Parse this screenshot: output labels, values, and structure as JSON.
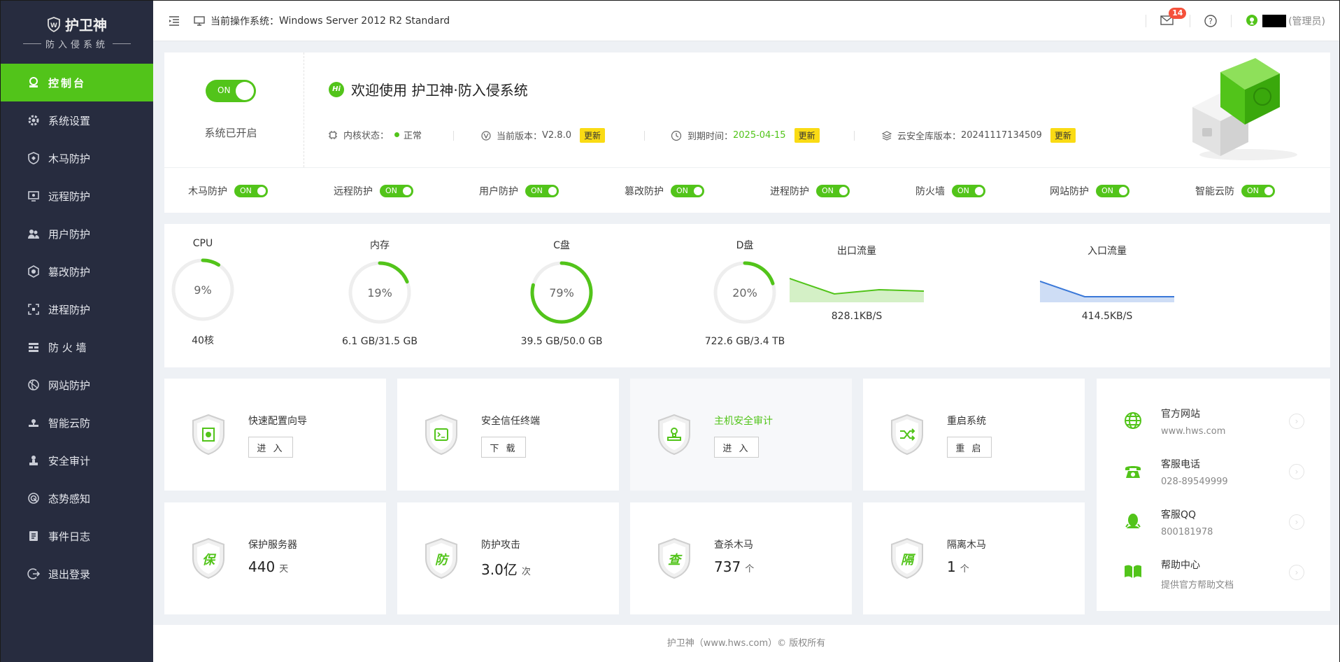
{
  "brand": {
    "name": "护卫神",
    "subtitle": "防入侵系统"
  },
  "sidebar": {
    "items": [
      {
        "label": "控制台",
        "icon": "dashboard-icon",
        "active": true
      },
      {
        "label": "系统设置",
        "icon": "gear-icon"
      },
      {
        "label": "木马防护",
        "icon": "shield-icon"
      },
      {
        "label": "远程防护",
        "icon": "remote-desktop-icon"
      },
      {
        "label": "用户防护",
        "icon": "users-icon"
      },
      {
        "label": "篡改防护",
        "icon": "tamper-icon"
      },
      {
        "label": "进程防护",
        "icon": "process-icon"
      },
      {
        "label": "防 火 墙",
        "icon": "firewall-icon"
      },
      {
        "label": "网站防护",
        "icon": "website-icon"
      },
      {
        "label": "智能云防",
        "icon": "cloud-icon"
      },
      {
        "label": "安全审计",
        "icon": "audit-icon"
      },
      {
        "label": "态势感知",
        "icon": "radar-icon"
      },
      {
        "label": "事件日志",
        "icon": "log-icon"
      },
      {
        "label": "退出登录",
        "icon": "logout-icon"
      }
    ]
  },
  "topbar": {
    "os_label": "当前操作系统：",
    "os_value": "Windows Server 2012 R2 Standard",
    "mail_count": "14",
    "user_role": "(管理员)"
  },
  "status": {
    "switch_label": "ON",
    "system_state": "系统已开启",
    "welcome": "欢迎使用 护卫神·防入侵系统",
    "hi_badge": "Hi",
    "kernel_label": "内核状态：",
    "kernel_value": "正常",
    "version_label": "当前版本：",
    "version_value": "V2.8.0",
    "expire_label": "到期时间：",
    "expire_value": "2025-04-15",
    "cloud_label": "云安全库版本：",
    "cloud_value": "20241117134509",
    "update_label": "更新"
  },
  "protections": [
    {
      "label": "木马防护",
      "state": "ON"
    },
    {
      "label": "远程防护",
      "state": "ON"
    },
    {
      "label": "用户防护",
      "state": "ON"
    },
    {
      "label": "篡改防护",
      "state": "ON"
    },
    {
      "label": "进程防护",
      "state": "ON"
    },
    {
      "label": "防火墙",
      "state": "ON"
    },
    {
      "label": "网站防护",
      "state": "ON"
    },
    {
      "label": "智能云防",
      "state": "ON"
    }
  ],
  "gauges": [
    {
      "label": "CPU",
      "percent": 9,
      "percent_text": "9%",
      "detail": "40核"
    },
    {
      "label": "内存",
      "percent": 19,
      "percent_text": "19%",
      "detail": "6.1 GB/31.5 GB"
    },
    {
      "label": "C盘",
      "percent": 79,
      "percent_text": "79%",
      "detail": "39.5 GB/50.0 GB"
    },
    {
      "label": "D盘",
      "percent": 20,
      "percent_text": "20%",
      "detail": "722.6 GB/3.4 TB"
    }
  ],
  "traffic": [
    {
      "label": "出口流量",
      "value": "828.1KB/S",
      "color": "#52c41a",
      "points": [
        34,
        12,
        18,
        16
      ]
    },
    {
      "label": "入口流量",
      "value": "414.5KB/S",
      "color": "#3a78d8",
      "points": [
        30,
        8,
        8,
        8
      ]
    }
  ],
  "actions": [
    {
      "title": "快速配置向导",
      "button": "进 入",
      "icon": "wizard-icon"
    },
    {
      "title": "安全信任终端",
      "button": "下 载",
      "icon": "terminal-icon"
    },
    {
      "title": "主机安全审计",
      "button": "进 入",
      "icon": "stamp-icon",
      "highlight": true
    },
    {
      "title": "重启系统",
      "button": "重 启",
      "icon": "shuffle-icon"
    }
  ],
  "counters": [
    {
      "title": "保护服务器",
      "value": "440",
      "unit": "天",
      "glyph": "保"
    },
    {
      "title": "防护攻击",
      "value": "3.0亿",
      "unit": "次",
      "glyph": "防"
    },
    {
      "title": "查杀木马",
      "value": "737",
      "unit": "个",
      "glyph": "查"
    },
    {
      "title": "隔离木马",
      "value": "1",
      "unit": "个",
      "glyph": "隔"
    }
  ],
  "contacts": [
    {
      "title": "官方网站",
      "sub": "www.hws.com",
      "icon": "globe-icon"
    },
    {
      "title": "客服电话",
      "sub": "028-89549999",
      "icon": "phone-icon"
    },
    {
      "title": "客服QQ",
      "sub": "800181978",
      "icon": "qq-icon"
    },
    {
      "title": "帮助中心",
      "sub": "提供官方帮助文档",
      "icon": "book-icon"
    }
  ],
  "footer": "护卫神（www.hws.com）© 版权所有",
  "colors": {
    "accent": "#52c41a",
    "sidebar": "#272c3f",
    "update": "#fadb14",
    "badge": "#f5513b"
  }
}
